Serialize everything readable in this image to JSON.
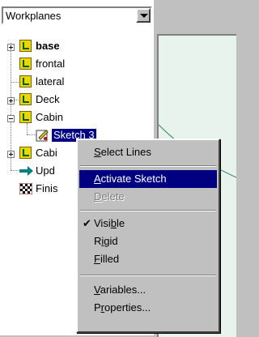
{
  "combo": {
    "value": "Workplanes"
  },
  "tree": {
    "items": [
      {
        "label": "base",
        "bold": true
      },
      {
        "label": "frontal"
      },
      {
        "label": "lateral"
      },
      {
        "label": "Deck"
      },
      {
        "label": "Cabin"
      },
      {
        "label": "Sketch 3"
      },
      {
        "label": "Cabi"
      },
      {
        "label": "Upd"
      },
      {
        "label": "Finis"
      }
    ]
  },
  "menu": {
    "select_lines": {
      "pre": "",
      "ul": "S",
      "post": "elect Lines"
    },
    "activate_sketch": {
      "pre": "",
      "ul": "A",
      "post": "ctivate Sketch"
    },
    "delete": {
      "pre": "",
      "ul": "D",
      "post": "elete"
    },
    "visible": {
      "pre": "Visi",
      "ul": "b",
      "post": "le",
      "checked": "✔"
    },
    "rigid": {
      "pre": "R",
      "ul": "i",
      "post": "gid"
    },
    "filled": {
      "pre": "",
      "ul": "F",
      "post": "illed"
    },
    "variables": {
      "pre": "",
      "ul": "V",
      "post": "ariables..."
    },
    "properties": {
      "pre": "P",
      "ul": "r",
      "post": "operties..."
    }
  },
  "colors": {
    "highlight": "#000080",
    "viewport": "#e8f3ee"
  }
}
